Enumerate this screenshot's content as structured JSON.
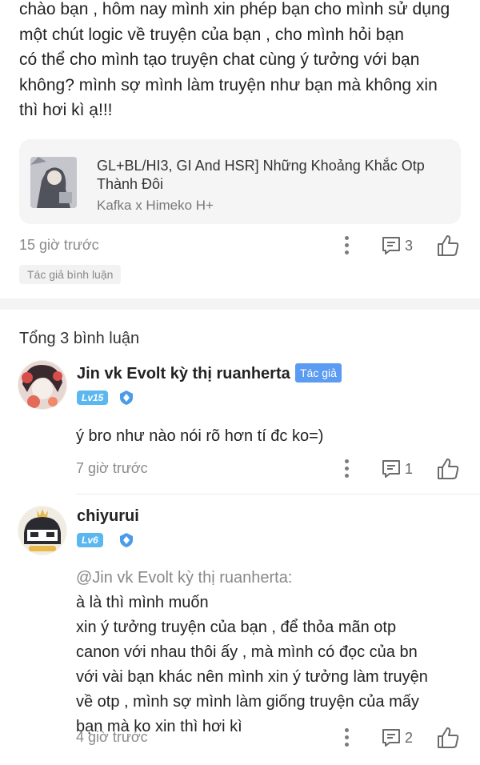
{
  "main_comment": {
    "lines": [
      "chào bạn , hôm nay mình xin phép bạn cho mình sử dụng",
      "một chút logic về truyện của bạn , cho mình hỏi bạn",
      "có thể cho mình tạo truyện chat cùng ý tưởng với bạn",
      "không? mình sợ mình làm truyện như bạn mà không xin",
      "thì hơi kì ạ!!!"
    ],
    "story_card": {
      "title": "GL+BL/HI3, GI And HSR] Những Khoảng Khắc Otp Thành Đôi",
      "subtitle": "Kafka x Himeko H+"
    },
    "time": "15 giờ trước",
    "reply_count": "3",
    "author_tag": "Tác giả bình luận"
  },
  "total_label": "Tổng 3 bình luận",
  "replies": [
    {
      "username": "Jin vk Evolt kỳ thị ruanherta",
      "badge": "Tác giả",
      "level": "Lv15",
      "lines": [
        "ý bro như nào nói rõ hơn tí đc ko=)"
      ],
      "time": "7 giờ trước",
      "reply_count": "1"
    },
    {
      "username": "chiyurui",
      "level": "Lv6",
      "mention": "@Jin vk Evolt kỳ thị ruanherta:",
      "first_line_rest": " à là thì mình muốn",
      "lines": [
        "xin ý tưởng truyện của bạn , để thỏa mãn otp",
        "canon với nhau thôi ấy , mà mình có đọc của bn",
        "với vài bạn khác nên mình xin ý tưởng làm truyện",
        "về otp , mình sợ mình làm giống truyện của mấy",
        "bạn mà ko xin thì hơi kì"
      ],
      "time": "4 giờ trước",
      "reply_count": "2"
    }
  ],
  "icons": {
    "more": "more-vertical-icon",
    "reply": "comment-icon",
    "like": "thumbs-up-icon",
    "shield": "shield-icon"
  },
  "colors": {
    "author_badge": "#5b9bf2",
    "level_badge": "#5bb7f0",
    "muted": "#8a8a8a"
  }
}
